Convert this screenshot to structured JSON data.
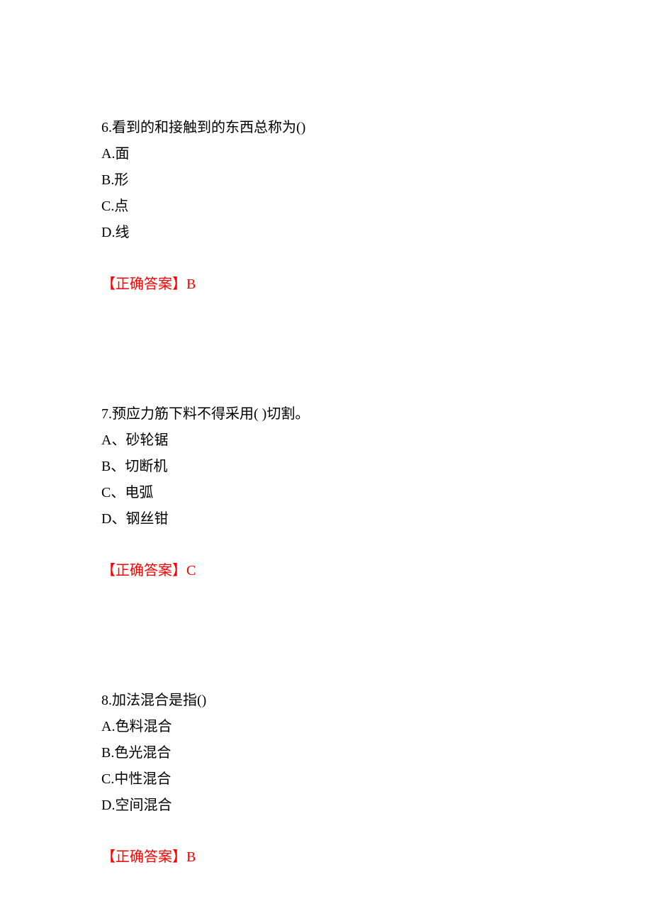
{
  "questions": [
    {
      "stem": "6.看到的和接触到的东西总称为()",
      "options": [
        "A.面",
        "B.形",
        "C.点",
        "D.线"
      ],
      "answer_label": "【正确答案】",
      "answer_value": "B"
    },
    {
      "stem": "7.预应力筋下料不得采用(  )切割。",
      "options": [
        "A、砂轮锯",
        "B、切断机",
        "C、电弧",
        "D、钢丝钳"
      ],
      "answer_label": "【正确答案】",
      "answer_value": "C"
    },
    {
      "stem": "8.加法混合是指()",
      "options": [
        "A.色料混合",
        "B.色光混合",
        "C.中性混合",
        "D.空间混合"
      ],
      "answer_label": "【正确答案】",
      "answer_value": "B"
    }
  ]
}
